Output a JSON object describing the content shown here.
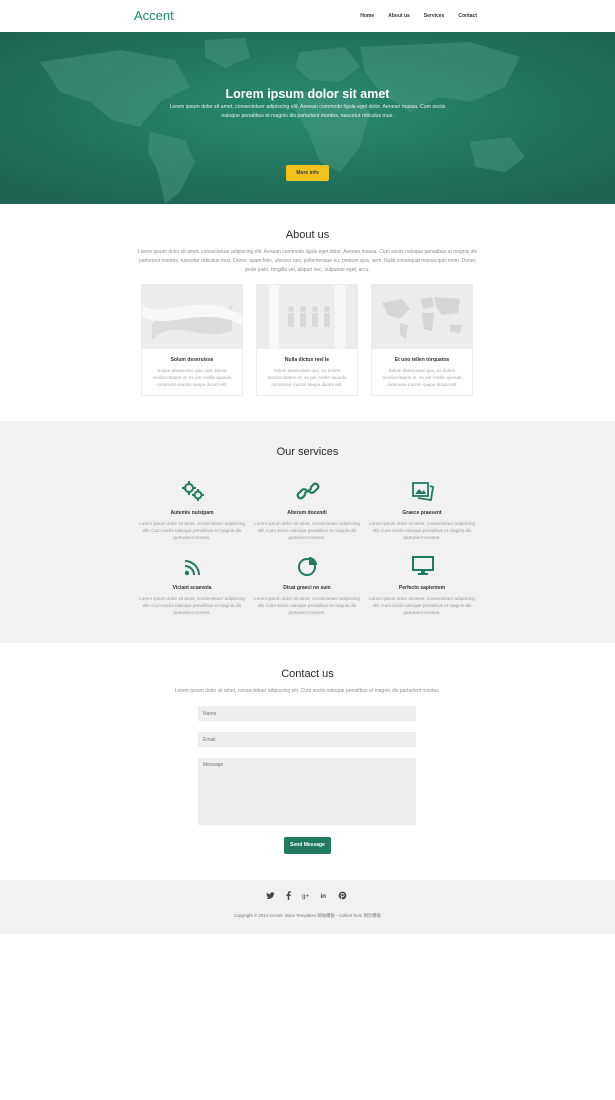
{
  "header": {
    "logo": "Accent",
    "nav": [
      "Home",
      "About us",
      "Services",
      "Contact"
    ]
  },
  "hero": {
    "title": "Lorem ipsum dolor sit amet",
    "text": "Lorem ipsum dolor sit amet, consectetuer adipiscing elit. Aenean commodo ligula eget dolor. Aenean massa. Cum sociis natoque penatibus et magnis dis parturient montes, nascetur ridiculus mus.",
    "button": "More info"
  },
  "about": {
    "title": "About us",
    "text": "Lorem ipsum dolor sit amet, consectetuer adipiscing elit. Aenean commodo ligula eget dolor. Aenean massa. Cum sociis natoque penatibus et magnis dis parturient montes, nascetur ridiculus mus. Donec quam felis, ultricies nec, pellentesque eu, pretium quis, sem. Nulla consequat massa quis enim. Donec pede justo, fringilla vel, aliquet nec, vulputate eget, arcu.",
    "cards": [
      {
        "title": "Solum deseruisse",
        "text": "Solum deseruisse quo, ans dolore mediocritatem ut, ex per mollis quando commune mazim saepe dicant est."
      },
      {
        "title": "Nulla dictus reel le",
        "text": "Solum deseruisse quo, ex dolore mediocritatem ut, ex per mollis quando commune mazim saepe dicant est."
      },
      {
        "title": "Et uno tellen torquatos",
        "text": "Solum deseruisse quo, ex dolore mediocritatem ut, ex per mollis quando commune mazim saepe dicant est."
      }
    ]
  },
  "services": {
    "title": "Our services",
    "items": [
      {
        "icon": "gears-icon",
        "title": "Autemis nuisipam",
        "text": "Lorem ipsum dolor sit amet, consectetuer adipiscing elit. Cum sociis natoque penatibus et magnis dis parturient montes."
      },
      {
        "icon": "chain-link-icon",
        "title": "Alterum docendi",
        "text": "Lorem ipsum dolor sit amet, consectetuer adipiscing elit. Cum sociis natoque penatibus et magnis dis parturient montes."
      },
      {
        "icon": "photos-icon",
        "title": "Graece praesent",
        "text": "Lorem ipsum dolor sit amet, consectetuer adipiscing elit. Cum sociis natoque penatibus et magnis dis parturient montes."
      },
      {
        "icon": "wifi-signal-icon",
        "title": "Viciant scaevola",
        "text": "Lorem ipsum dolor sit amet, consectetuer adipiscing elit. Cum sociis natoque penatibus et magnis dis parturient montes."
      },
      {
        "icon": "pie-chart-icon",
        "title": "Dicat graeci no sum",
        "text": "Lorem ipsum dolor sit amet, consectetuer adipiscing elit. Cum sociis natoque penatibus et magnis dis parturient montes."
      },
      {
        "icon": "monitor-icon",
        "title": "Perfecto sapientem",
        "text": "Lorem ipsum dolor sit amet, consectetuer adipiscing elit. Cum sociis natoque penatibus et magnis dis parturient montes."
      }
    ]
  },
  "contact": {
    "title": "Contact us",
    "text": "Lorem ipsum dolor sit amet, consectetuer adipiscing elit. Cum sociis natoque penatibus et magnis dis parturient montes.",
    "name_placeholder": "Name",
    "email_placeholder": "Email",
    "message_placeholder": "Message",
    "button": "Send Message"
  },
  "footer": {
    "social": [
      "twitter-icon",
      "facebook-icon",
      "google-plus-icon",
      "linkedin-icon",
      "pinterest-icon"
    ],
    "social_glyphs": [
      "𝕥",
      "f",
      "g+",
      "in",
      "℗"
    ],
    "copyright": "Copyright © 2014 Accent. More Templates 网站模板 - Collect from 网页模板"
  },
  "colors": {
    "accent": "#1f7a60",
    "hero_bg": "#1f705b",
    "button_yellow": "#f2c21a",
    "section_gray": "#f1f1f1"
  }
}
